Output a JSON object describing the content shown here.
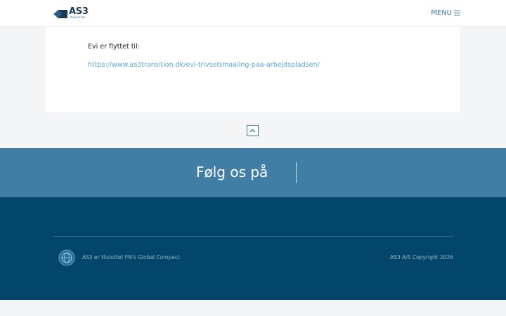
{
  "header": {
    "logo_text": "AS3",
    "logo_subtext": "TRANSITION",
    "menu_label": "MENU"
  },
  "content": {
    "moved_text": "Evi er flyttet til:",
    "moved_link": "https://www.as3transition.dk/evi-trivselsmaaling-paa-arbejdspladsen/"
  },
  "follow": {
    "title": "Følg os på"
  },
  "footer": {
    "global_compact_text": "AS3 er tilsluttet FN's Global Compact",
    "copyright": "AS3 A/S Copyright 2026"
  },
  "colors": {
    "brand_dark": "#03466b",
    "brand_mid": "#417ea6",
    "link": "#5aa8cc"
  },
  "icons": {
    "logo": "as3-logo-icon",
    "menu": "hamburger-icon",
    "to_top": "chevron-up-icon",
    "global_compact": "un-global-compact-icon"
  }
}
